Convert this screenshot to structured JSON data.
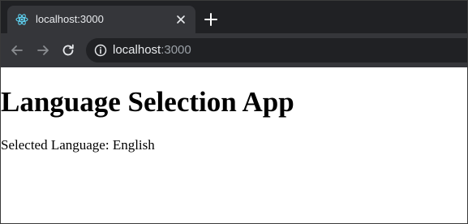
{
  "browser": {
    "tab": {
      "title": "localhost:3000",
      "favicon": "react-logo-icon",
      "close_icon": "close-icon"
    },
    "new_tab_icon": "plus-icon",
    "toolbar": {
      "back_icon": "arrow-left-icon",
      "forward_icon": "arrow-right-icon",
      "reload_icon": "reload-icon",
      "site_info_icon": "info-icon",
      "url_host": "localhost",
      "url_port": ":3000"
    },
    "colors": {
      "tabstrip_bg": "#202124",
      "toolbar_bg": "#35363a",
      "omnibox_bg": "#202124",
      "text": "#e8eaed",
      "muted_text": "#9aa0a6",
      "react_accent": "#61dafb"
    }
  },
  "page": {
    "heading": "Language Selection App",
    "selected_label": "Selected Language:",
    "selected_value": "English"
  }
}
